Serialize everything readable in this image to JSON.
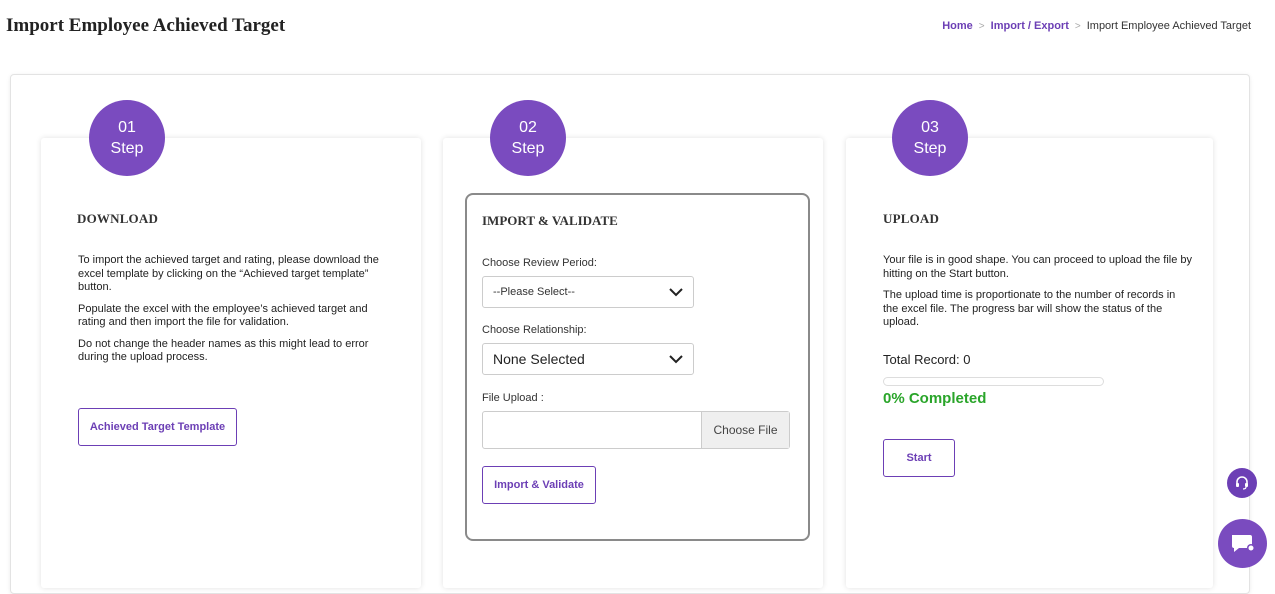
{
  "page": {
    "title": "Import Employee Achieved Target"
  },
  "breadcrumb": {
    "home": "Home",
    "import_export": "Import / Export",
    "current": "Import Employee Achieved Target"
  },
  "steps": [
    {
      "number": "01",
      "label": "Step",
      "heading": "DOWNLOAD",
      "paragraphs": [
        "To import the achieved target and rating, please download the excel template by clicking on the “Achieved target template” button.",
        "Populate the excel with the employee’s achieved target and rating and then import the file for validation.",
        "Do not change the header names as this might lead to error during the upload process."
      ],
      "button": "Achieved Target Template"
    },
    {
      "number": "02",
      "label": "Step",
      "heading": "IMPORT & VALIDATE",
      "review_period_label": "Choose Review Period:",
      "review_period_value": "--Please Select--",
      "relationship_label": "Choose Relationship:",
      "relationship_value": "None Selected",
      "file_upload_label": "File Upload :",
      "choose_file": "Choose File",
      "button": "Import & Validate"
    },
    {
      "number": "03",
      "label": "Step",
      "heading": "UPLOAD",
      "paragraphs": [
        "Your file is in good shape. You can proceed to upload the file by hitting on the Start button.",
        "The upload time is proportionate to the number of records in the excel file. The progress bar will show the status of the upload."
      ],
      "total_record": "Total Record: 0",
      "progress_percent": 0,
      "completed": "0% Completed",
      "button": "Start"
    }
  ],
  "colors": {
    "brand": "#7a4bbf",
    "link": "#6c3fb5",
    "success": "#2aa52a"
  },
  "icons": {
    "support": "headset-icon",
    "chat": "chat-icon",
    "chevron": "chevron-down-icon"
  }
}
